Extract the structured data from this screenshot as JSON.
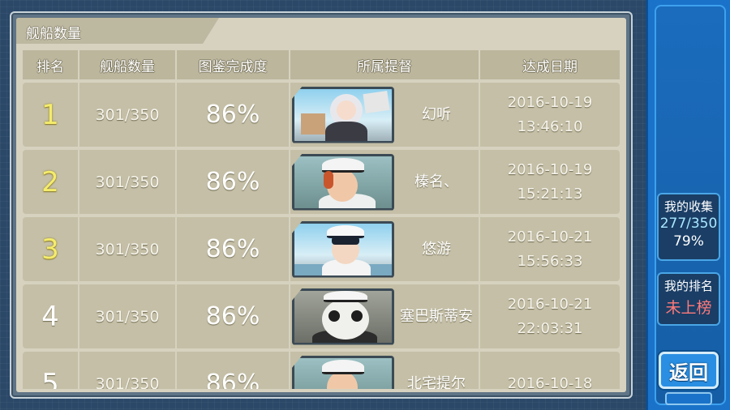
{
  "panel": {
    "title": "舰船数量"
  },
  "table": {
    "headers": [
      "排名",
      "舰船数量",
      "图鉴完成度",
      "所属提督",
      "达成日期"
    ],
    "rows": [
      {
        "rank": "1",
        "count": "301/350",
        "percent": "86%",
        "admiral": "幻听",
        "date": "2016-10-19",
        "time": "13:46:10",
        "portrait": "white-haired-girl-portrait"
      },
      {
        "rank": "2",
        "count": "301/350",
        "percent": "86%",
        "admiral": "榛名、",
        "date": "2016-10-19",
        "time": "15:21:13",
        "portrait": "redhead-man-portrait"
      },
      {
        "rank": "3",
        "count": "301/350",
        "percent": "86%",
        "admiral": "悠游",
        "date": "2016-10-21",
        "time": "15:56:33",
        "portrait": "naval-officer-portrait"
      },
      {
        "rank": "4",
        "count": "301/350",
        "percent": "86%",
        "admiral": "塞巴斯蒂安",
        "date": "2016-10-21",
        "time": "22:03:31",
        "portrait": "panda-meme-portrait"
      },
      {
        "rank": "5",
        "count": "301/350",
        "percent": "86%",
        "admiral": "北宅提尔",
        "date": "2016-10-18",
        "time": "",
        "portrait": "redhead-man-portrait"
      }
    ]
  },
  "sidebar": {
    "collection_title": "我的收集",
    "collection_count": "277/350",
    "collection_percent": "79%",
    "rank_title": "我的排名",
    "rank_value": "未上榜",
    "back_label": "返回"
  },
  "colors": {
    "panel_bg": "#d6d2bf",
    "row_bg": "#c4bfa6",
    "top_rank": "#f4ec6c",
    "sidebar_blue": "#1a73c9",
    "rank_red": "#ff7a7a"
  }
}
